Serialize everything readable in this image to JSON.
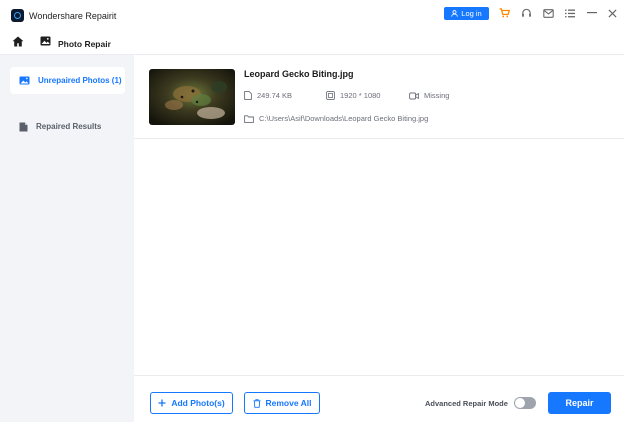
{
  "app": {
    "title": "Wondershare Repairit"
  },
  "header": {
    "login_label": "Log in"
  },
  "nav": {
    "title": "Photo Repair"
  },
  "sidebar": {
    "items": [
      {
        "label": "Unrepaired Photos (1)"
      },
      {
        "label": "Repaired Results"
      }
    ]
  },
  "file": {
    "name": "Leopard Gecko Biting.jpg",
    "size": "249.74  KB",
    "resolution": "1920 * 1080",
    "camera": "Missing",
    "path": "C:\\Users\\Asif\\Downloads\\Leopard Gecko Biting.jpg"
  },
  "footer": {
    "add_label": "Add Photo(s)",
    "remove_label": "Remove All",
    "advanced_label": "Advanced Repair Mode",
    "repair_label": "Repair"
  },
  "colors": {
    "accent": "#1677ff",
    "cart": "#ff8a00",
    "sidebar_bg": "#f2f4f7"
  }
}
